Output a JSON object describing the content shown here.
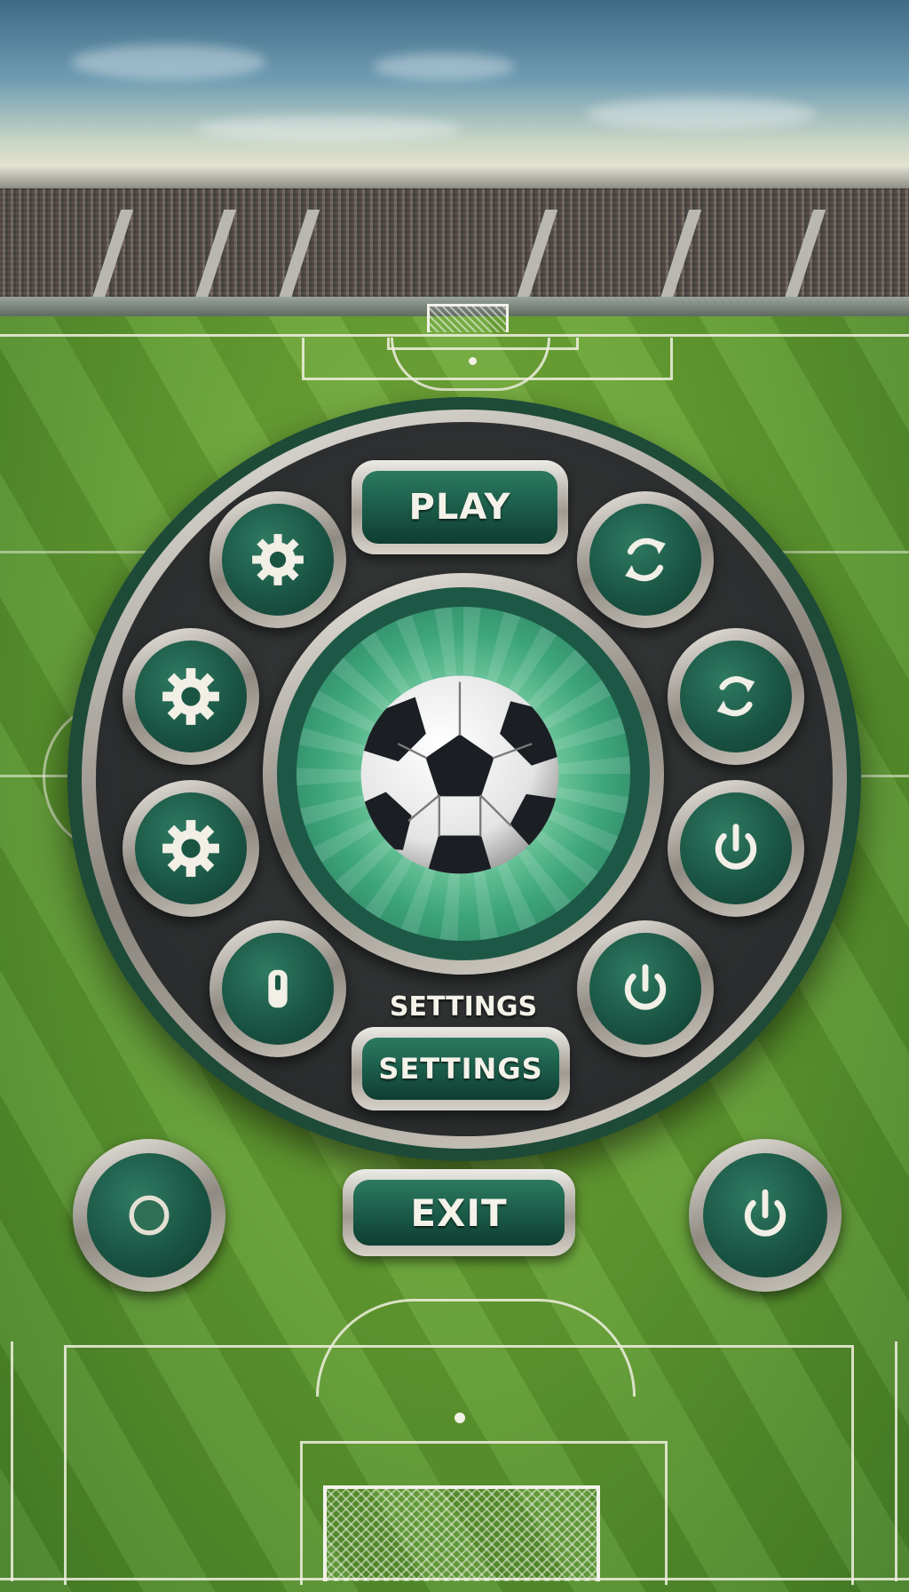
{
  "menu": {
    "play_label": "PLAY",
    "settings_caption": "SETTINGS",
    "settings_label": "SETTINGS",
    "exit_label": "EXIT"
  },
  "icons": {
    "top_left": "gear-icon",
    "top_right": "refresh-icon",
    "mid_left_upper": "gear-icon",
    "mid_right_upper": "refresh-icon",
    "mid_left_lower": "gear-icon",
    "mid_right_lower": "power-icon",
    "low_left": "device-icon",
    "low_right": "power-icon",
    "bottom_left": "circle-icon",
    "bottom_right": "power-icon",
    "center": "soccer-ball-icon"
  },
  "colors": {
    "button_green": "#1a5544",
    "ring_silver": "#d6d2c8",
    "dial_dark": "#2a2c2d",
    "hub_glow": "#7fd2a8",
    "pitch_green": "#5f9a2f"
  }
}
